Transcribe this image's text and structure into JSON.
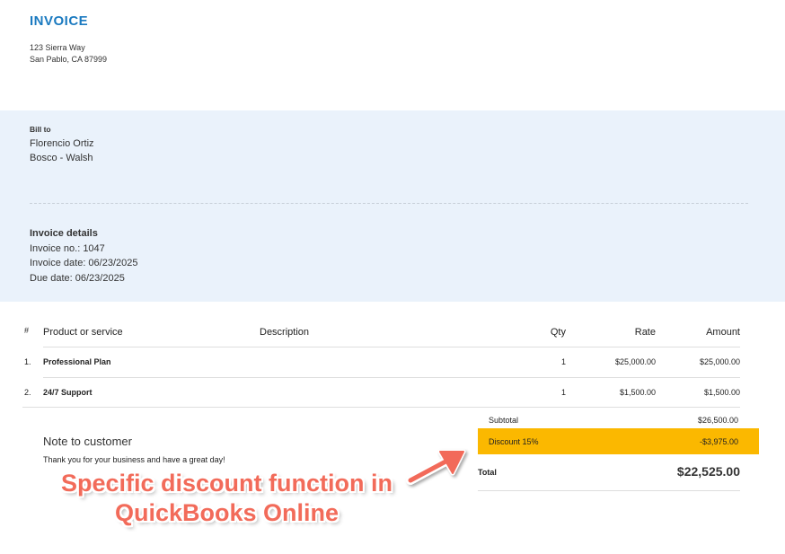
{
  "header": {
    "title": "INVOICE",
    "address_line1": "123 Sierra Way",
    "address_line2": "San Pablo, CA 87999"
  },
  "bill_to": {
    "label": "Bill to",
    "name": "Florencio Ortiz",
    "company": "Bosco - Walsh"
  },
  "invoice_details": {
    "heading": "Invoice details",
    "number": "Invoice no.: 1047",
    "date": "Invoice date: 06/23/2025",
    "due": "Due date: 06/23/2025"
  },
  "table": {
    "headers": {
      "num": "#",
      "product": "Product or service",
      "description": "Description",
      "qty": "Qty",
      "rate": "Rate",
      "amount": "Amount"
    },
    "rows": [
      {
        "num": "1.",
        "product": "Professional Plan",
        "description": "",
        "qty": "1",
        "rate": "$25,000.00",
        "amount": "$25,000.00"
      },
      {
        "num": "2.",
        "product": "24/7 Support",
        "description": "",
        "qty": "1",
        "rate": "$1,500.00",
        "amount": "$1,500.00"
      }
    ]
  },
  "note": {
    "heading": "Note to customer",
    "text": "Thank you for your business and have a great day!"
  },
  "totals": {
    "subtotal_label": "Subtotal",
    "subtotal_value": "$26,500.00",
    "discount_label": "Discount 15%",
    "discount_value": "-$3,975.00",
    "total_label": "Total",
    "total_value": "$22,525.00",
    "highlight_color": "#fbb800"
  },
  "annotation": {
    "line1": "Specific discount function in",
    "line2": "QuickBooks Online",
    "color": "#f26b5a"
  }
}
